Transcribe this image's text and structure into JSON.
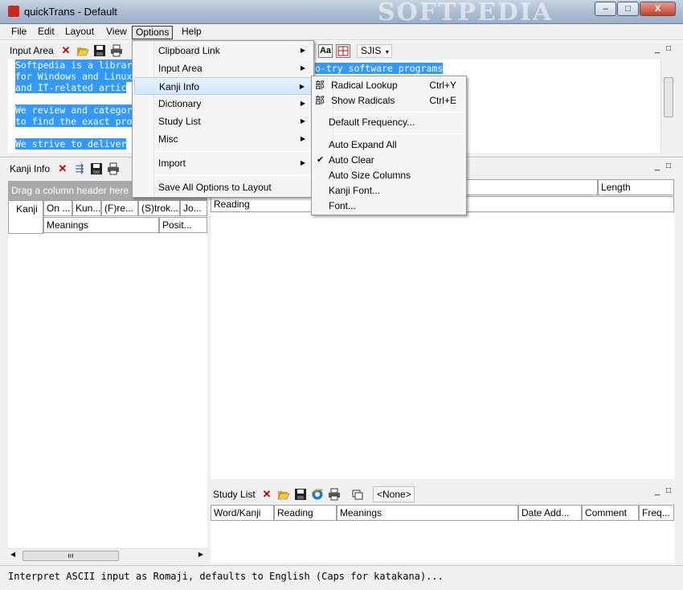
{
  "window": {
    "title": "quickTrans - Default",
    "watermark": "SOFTPEDIA"
  },
  "window_buttons": {
    "minimize": "–",
    "maximize": "□",
    "close": "X"
  },
  "menubar": {
    "items": [
      "File",
      "Edit",
      "Layout",
      "View",
      "Options",
      "Help"
    ]
  },
  "input_area": {
    "label": "Input Area",
    "encoding": "SJIS",
    "font_button": "Aa",
    "lines": [
      "Softpedia is a librar",
      "for Windows and Linux",
      "and IT-related artic",
      "",
      "We review and categor",
      "to find the exact pro",
      "",
      "We strive to deliver"
    ],
    "right_fragment": "o-try software programs"
  },
  "kanji_info": {
    "label": "Kanji Info",
    "group_hint": "Drag a column header here",
    "columns_row1": [
      "Kanji",
      "On ...",
      "Kun...",
      "(F)re...",
      "(S)trok...",
      "Jo..."
    ],
    "columns_row2": [
      "Meanings",
      "Posit..."
    ]
  },
  "dictionary": {
    "columns": [
      "Length"
    ],
    "row2": [
      "Reading"
    ]
  },
  "study_list": {
    "label": "Study List",
    "combo_value": "<None>",
    "columns": [
      "Word/Kanji",
      "Reading",
      "Meanings",
      "Date Add...",
      "Comment",
      "Freq..."
    ]
  },
  "options_menu": {
    "items": [
      "Clipboard Link",
      "Input Area",
      "Kanji Info",
      "Dictionary",
      "Study List",
      "Misc",
      "Import",
      "Save All Options to Layout"
    ]
  },
  "kanji_info_submenu": {
    "items": [
      {
        "label": "Radical Lookup",
        "shortcut": "Ctrl+Y"
      },
      {
        "label": "Show Radicals",
        "shortcut": "Ctrl+E"
      },
      {
        "label": "Default Frequency..."
      },
      {
        "label": "Auto Expand All"
      },
      {
        "label": "Auto Clear",
        "checked": "✔"
      },
      {
        "label": "Auto Size Columns"
      },
      {
        "label": "Kanji Font..."
      },
      {
        "label": "Font..."
      }
    ]
  },
  "status": {
    "text": "Interpret ASCII input as Romaji, defaults to English (Caps for katakana)..."
  },
  "icons": {
    "close": "✕",
    "open": "folder-open-icon",
    "save": "floppy-icon",
    "print": "printer-icon",
    "web": "ie-icon",
    "copy": "copy-icon",
    "kanji_radical": "部"
  }
}
